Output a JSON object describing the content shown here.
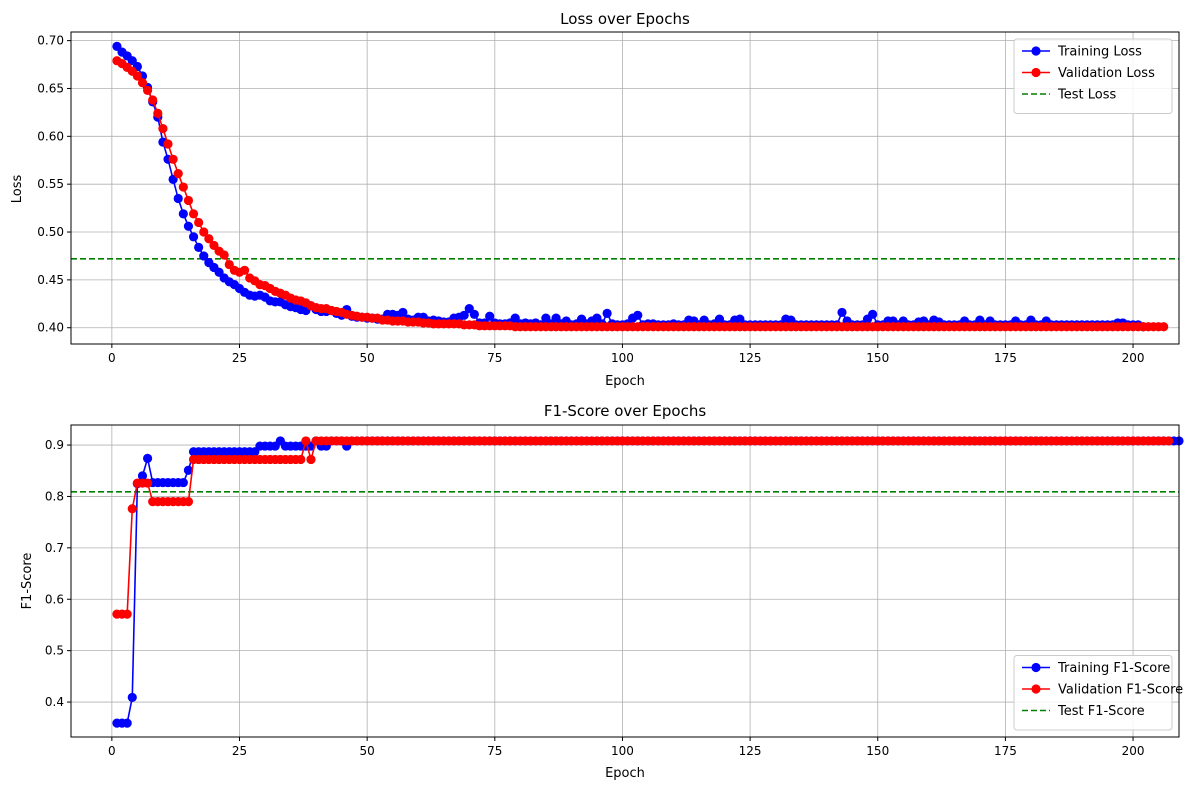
{
  "chart_data": [
    {
      "type": "line",
      "title": "Loss over Epochs",
      "xlabel": "Epoch",
      "ylabel": "Loss",
      "xlim": [
        -8,
        209
      ],
      "ylim": [
        0.383,
        0.709
      ],
      "xticks": [
        0,
        25,
        50,
        75,
        100,
        125,
        150,
        175,
        200
      ],
      "yticks": [
        0.4,
        0.45,
        0.5,
        0.55,
        0.6,
        0.65,
        0.7
      ],
      "ytick_format": 2,
      "grid": true,
      "legend_position": "top-right",
      "x_start": 1,
      "series": [
        {
          "name": "Training Loss",
          "color": "#0000ff",
          "marker": "circle",
          "values": [
            0.694,
            0.688,
            0.684,
            0.679,
            0.673,
            0.663,
            0.651,
            0.636,
            0.62,
            0.594,
            0.576,
            0.555,
            0.535,
            0.519,
            0.506,
            0.495,
            0.484,
            0.475,
            0.468,
            0.463,
            0.458,
            0.452,
            0.448,
            0.445,
            0.441,
            0.437,
            0.434,
            0.433,
            0.434,
            0.432,
            0.428,
            0.427,
            0.427,
            0.424,
            0.422,
            0.421,
            0.419,
            0.418,
            0.423,
            0.419,
            0.417,
            0.417,
            0.418,
            0.415,
            0.413,
            0.419,
            0.412,
            0.411,
            0.411,
            0.41,
            0.41,
            0.409,
            0.409,
            0.414,
            0.414,
            0.413,
            0.416,
            0.409,
            0.408,
            0.411,
            0.411,
            0.407,
            0.408,
            0.407,
            0.406,
            0.406,
            0.41,
            0.411,
            0.413,
            0.42,
            0.414,
            0.405,
            0.405,
            0.412,
            0.405,
            0.404,
            0.404,
            0.405,
            0.41,
            0.404,
            0.405,
            0.404,
            0.405,
            0.403,
            0.41,
            0.404,
            0.41,
            0.404,
            0.407,
            0.403,
            0.404,
            0.409,
            0.404,
            0.407,
            0.41,
            0.404,
            0.415,
            0.404,
            0.403,
            0.403,
            0.404,
            0.41,
            0.413,
            0.403,
            0.404,
            0.404,
            0.403,
            0.403,
            0.403,
            0.404,
            0.403,
            0.403,
            0.408,
            0.407,
            0.403,
            0.408,
            0.403,
            0.404,
            0.409,
            0.403,
            0.403,
            0.408,
            0.409,
            0.403,
            0.403,
            0.403,
            0.403,
            0.403,
            0.403,
            0.403,
            0.403,
            0.409,
            0.408,
            0.403,
            0.403,
            0.403,
            0.403,
            0.403,
            0.403,
            0.403,
            0.403,
            0.403,
            0.416,
            0.407,
            0.403,
            0.403,
            0.403,
            0.409,
            0.414,
            0.403,
            0.403,
            0.407,
            0.407,
            0.403,
            0.407,
            0.403,
            0.403,
            0.406,
            0.407,
            0.403,
            0.408,
            0.406,
            0.403,
            0.403,
            0.403,
            0.403,
            0.407,
            0.403,
            0.403,
            0.408,
            0.403,
            0.407,
            0.403,
            0.403,
            0.403,
            0.403,
            0.407,
            0.403,
            0.403,
            0.408,
            0.403,
            0.403,
            0.407,
            0.403,
            0.403,
            0.403,
            0.403,
            0.403,
            0.403,
            0.403,
            0.403,
            0.403,
            0.403,
            0.403,
            0.403,
            0.403,
            0.405,
            0.405,
            0.403,
            0.403,
            0.403,
            0.401
          ]
        },
        {
          "name": "Validation Loss",
          "color": "#ff0000",
          "marker": "circle",
          "values": [
            0.679,
            0.676,
            0.672,
            0.668,
            0.663,
            0.656,
            0.648,
            0.638,
            0.624,
            0.608,
            0.592,
            0.576,
            0.561,
            0.547,
            0.533,
            0.519,
            0.51,
            0.5,
            0.493,
            0.486,
            0.48,
            0.476,
            0.466,
            0.46,
            0.458,
            0.46,
            0.452,
            0.449,
            0.445,
            0.444,
            0.441,
            0.438,
            0.436,
            0.434,
            0.431,
            0.429,
            0.428,
            0.426,
            0.423,
            0.421,
            0.42,
            0.42,
            0.418,
            0.417,
            0.416,
            0.414,
            0.413,
            0.412,
            0.411,
            0.411,
            0.41,
            0.41,
            0.408,
            0.408,
            0.407,
            0.407,
            0.407,
            0.406,
            0.406,
            0.406,
            0.405,
            0.405,
            0.404,
            0.404,
            0.404,
            0.404,
            0.404,
            0.404,
            0.403,
            0.403,
            0.403,
            0.402,
            0.402,
            0.402,
            0.402,
            0.402,
            0.402,
            0.402,
            0.401,
            0.401,
            0.401,
            0.401,
            0.401,
            0.401,
            0.401,
            0.401,
            0.401,
            0.401,
            0.401,
            0.401,
            0.401,
            0.401,
            0.401,
            0.401,
            0.401,
            0.401,
            0.401,
            0.401,
            0.401,
            0.401,
            0.401,
            0.401,
            0.401,
            0.401,
            0.401,
            0.401,
            0.401,
            0.401,
            0.401,
            0.401,
            0.401,
            0.401,
            0.401,
            0.401,
            0.401,
            0.401,
            0.401,
            0.401,
            0.401,
            0.401,
            0.401,
            0.401,
            0.401,
            0.401,
            0.401,
            0.401,
            0.401,
            0.401,
            0.401,
            0.401,
            0.401,
            0.401,
            0.401,
            0.401,
            0.401,
            0.401,
            0.401,
            0.401,
            0.401,
            0.401,
            0.401,
            0.401,
            0.401,
            0.401,
            0.401,
            0.401,
            0.401,
            0.401,
            0.401,
            0.401,
            0.401,
            0.401,
            0.401,
            0.401,
            0.401,
            0.401,
            0.401,
            0.401,
            0.401,
            0.401,
            0.401,
            0.401,
            0.401,
            0.401,
            0.401,
            0.401,
            0.401,
            0.401,
            0.401,
            0.401,
            0.401,
            0.401,
            0.401,
            0.401,
            0.401,
            0.401,
            0.401,
            0.401,
            0.401,
            0.401,
            0.401,
            0.401,
            0.401,
            0.401,
            0.401,
            0.401,
            0.401,
            0.401,
            0.401,
            0.401,
            0.401,
            0.401,
            0.401,
            0.401,
            0.401,
            0.401,
            0.401,
            0.401,
            0.401,
            0.401,
            0.401,
            0.401,
            0.401,
            0.401,
            0.401,
            0.401
          ]
        }
      ],
      "hlines": [
        {
          "name": "Test Loss",
          "color": "#008000",
          "style": "dashed",
          "value": 0.472
        }
      ]
    },
    {
      "type": "line",
      "title": "F1-Score over Epochs",
      "xlabel": "Epoch",
      "ylabel": "F1-Score",
      "xlim": [
        -8,
        209
      ],
      "ylim": [
        0.332,
        0.939
      ],
      "xticks": [
        0,
        25,
        50,
        75,
        100,
        125,
        150,
        175,
        200
      ],
      "yticks": [
        0.4,
        0.5,
        0.6,
        0.7,
        0.8,
        0.9
      ],
      "ytick_format": 1,
      "grid": true,
      "legend_position": "bottom-right",
      "x_start": 1,
      "series": [
        {
          "name": "Training F1-Score",
          "color": "#0000ff",
          "marker": "circle",
          "values": [
            0.359,
            0.359,
            0.359,
            0.409,
            0.825,
            0.84,
            0.874,
            0.827,
            0.827,
            0.827,
            0.827,
            0.827,
            0.827,
            0.827,
            0.851,
            0.887,
            0.887,
            0.887,
            0.887,
            0.887,
            0.887,
            0.887,
            0.887,
            0.887,
            0.887,
            0.887,
            0.887,
            0.887,
            0.898,
            0.898,
            0.898,
            0.898,
            0.908,
            0.898,
            0.898,
            0.898,
            0.898,
            0.898,
            0.898,
            0.908,
            0.898,
            0.898,
            0.908,
            0.908,
            0.908,
            0.898,
            0.908,
            0.908,
            0.908,
            0.908,
            0.908,
            0.908,
            0.908,
            0.908,
            0.908,
            0.908,
            0.908,
            0.908,
            0.908,
            0.908,
            0.908,
            0.908,
            0.908,
            0.908,
            0.908,
            0.908,
            0.908,
            0.908,
            0.908,
            0.908,
            0.908,
            0.908,
            0.908,
            0.908,
            0.908,
            0.908,
            0.908,
            0.908,
            0.908,
            0.908,
            0.908,
            0.908,
            0.908,
            0.908,
            0.908,
            0.908,
            0.908,
            0.908,
            0.908,
            0.908,
            0.908,
            0.908,
            0.908,
            0.908,
            0.908,
            0.908,
            0.908,
            0.908,
            0.908,
            0.908,
            0.908,
            0.908,
            0.908,
            0.908,
            0.908,
            0.908,
            0.908,
            0.908,
            0.908,
            0.908,
            0.908,
            0.908,
            0.908,
            0.908,
            0.908,
            0.908,
            0.908,
            0.908,
            0.908,
            0.908,
            0.908,
            0.908,
            0.908,
            0.908,
            0.908,
            0.908,
            0.908,
            0.908,
            0.908,
            0.908,
            0.908,
            0.908,
            0.908,
            0.908,
            0.908,
            0.908,
            0.908,
            0.908,
            0.908,
            0.908,
            0.908,
            0.908,
            0.908,
            0.908,
            0.908,
            0.908,
            0.908,
            0.908,
            0.908,
            0.908,
            0.908,
            0.908,
            0.908,
            0.908,
            0.908,
            0.908,
            0.908,
            0.908,
            0.908,
            0.908,
            0.908,
            0.908,
            0.908,
            0.908,
            0.908,
            0.908,
            0.908,
            0.908,
            0.908,
            0.908,
            0.908,
            0.908,
            0.908,
            0.908,
            0.908,
            0.908,
            0.908,
            0.908,
            0.908,
            0.908,
            0.908,
            0.908,
            0.908,
            0.908,
            0.908,
            0.908,
            0.908,
            0.908,
            0.908,
            0.908,
            0.908,
            0.908,
            0.908,
            0.908,
            0.908,
            0.908,
            0.908,
            0.908,
            0.908,
            0.908,
            0.908,
            0.908,
            0.908,
            0.908,
            0.908,
            0.908,
            0.908,
            0.908,
            0.908
          ]
        },
        {
          "name": "Validation F1-Score",
          "color": "#ff0000",
          "marker": "circle",
          "values": [
            0.571,
            0.571,
            0.571,
            0.776,
            0.826,
            0.826,
            0.826,
            0.79,
            0.79,
            0.79,
            0.79,
            0.79,
            0.79,
            0.79,
            0.79,
            0.872,
            0.872,
            0.872,
            0.872,
            0.872,
            0.872,
            0.872,
            0.872,
            0.872,
            0.872,
            0.872,
            0.872,
            0.872,
            0.872,
            0.872,
            0.872,
            0.872,
            0.872,
            0.872,
            0.872,
            0.872,
            0.872,
            0.908,
            0.872,
            0.908,
            0.908,
            0.908,
            0.908,
            0.908,
            0.908,
            0.908,
            0.908,
            0.908,
            0.908,
            0.908,
            0.908,
            0.908,
            0.908,
            0.908,
            0.908,
            0.908,
            0.908,
            0.908,
            0.908,
            0.908,
            0.908,
            0.908,
            0.908,
            0.908,
            0.908,
            0.908,
            0.908,
            0.908,
            0.908,
            0.908,
            0.908,
            0.908,
            0.908,
            0.908,
            0.908,
            0.908,
            0.908,
            0.908,
            0.908,
            0.908,
            0.908,
            0.908,
            0.908,
            0.908,
            0.908,
            0.908,
            0.908,
            0.908,
            0.908,
            0.908,
            0.908,
            0.908,
            0.908,
            0.908,
            0.908,
            0.908,
            0.908,
            0.908,
            0.908,
            0.908,
            0.908,
            0.908,
            0.908,
            0.908,
            0.908,
            0.908,
            0.908,
            0.908,
            0.908,
            0.908,
            0.908,
            0.908,
            0.908,
            0.908,
            0.908,
            0.908,
            0.908,
            0.908,
            0.908,
            0.908,
            0.908,
            0.908,
            0.908,
            0.908,
            0.908,
            0.908,
            0.908,
            0.908,
            0.908,
            0.908,
            0.908,
            0.908,
            0.908,
            0.908,
            0.908,
            0.908,
            0.908,
            0.908,
            0.908,
            0.908,
            0.908,
            0.908,
            0.908,
            0.908,
            0.908,
            0.908,
            0.908,
            0.908,
            0.908,
            0.908,
            0.908,
            0.908,
            0.908,
            0.908,
            0.908,
            0.908,
            0.908,
            0.908,
            0.908,
            0.908,
            0.908,
            0.908,
            0.908,
            0.908,
            0.908,
            0.908,
            0.908,
            0.908,
            0.908,
            0.908,
            0.908,
            0.908,
            0.908,
            0.908,
            0.908,
            0.908,
            0.908,
            0.908,
            0.908,
            0.908,
            0.908,
            0.908,
            0.908,
            0.908,
            0.908,
            0.908,
            0.908,
            0.908,
            0.908,
            0.908,
            0.908,
            0.908,
            0.908,
            0.908,
            0.908,
            0.908,
            0.908,
            0.908,
            0.908,
            0.908,
            0.908,
            0.908,
            0.908,
            0.908,
            0.908,
            0.908,
            0.908
          ]
        }
      ],
      "hlines": [
        {
          "name": "Test F1-Score",
          "color": "#008000",
          "style": "dashed",
          "value": 0.809
        }
      ]
    }
  ]
}
